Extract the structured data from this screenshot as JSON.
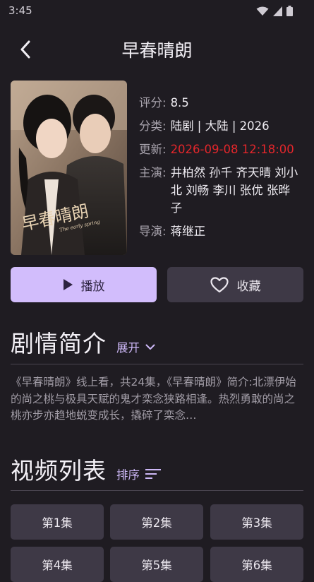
{
  "status": {
    "time": "3:45"
  },
  "header": {
    "title": "早春晴朗"
  },
  "info": {
    "rating_label": "评分",
    "rating": "8.5",
    "category_label": "分类",
    "category": "陆剧 | 大陆 | 2026",
    "updated_label": "更新",
    "updated": "2026-09-08 12:18:00",
    "cast_label": "主演",
    "cast": "井柏然 孙千 齐天晴 刘小北 刘畅 李川 张优 张晔子",
    "director_label": "导演",
    "director": "蒋继正"
  },
  "poster": {
    "title_art": "早春晴朗",
    "subtitle_art": "The early spring"
  },
  "actions": {
    "play_label": "播放",
    "favorite_label": "收藏"
  },
  "synopsis": {
    "title": "剧情简介",
    "expand_label": "展开",
    "text": "《早春晴朗》线上看，共24集，《早春晴朗》简介:北漂伊始的尚之桃与极具天赋的鬼才栾念狭路相逢。热烈勇敢的尚之桃亦步亦趋地蜕变成长，撬碎了栾念…"
  },
  "videos": {
    "title": "视频列表",
    "sort_label": "排序",
    "episodes": [
      "第1集",
      "第2集",
      "第3集",
      "第4集",
      "第5集",
      "第6集"
    ]
  },
  "colors": {
    "accent": "#d2bdfc",
    "highlight_red": "#e3262b",
    "background": "#1f1c22"
  },
  "icons": [
    "back-arrow-icon",
    "play-icon",
    "heart-icon",
    "chevron-down-icon",
    "sort-icon",
    "wifi-icon",
    "signal-icon",
    "battery-icon"
  ]
}
